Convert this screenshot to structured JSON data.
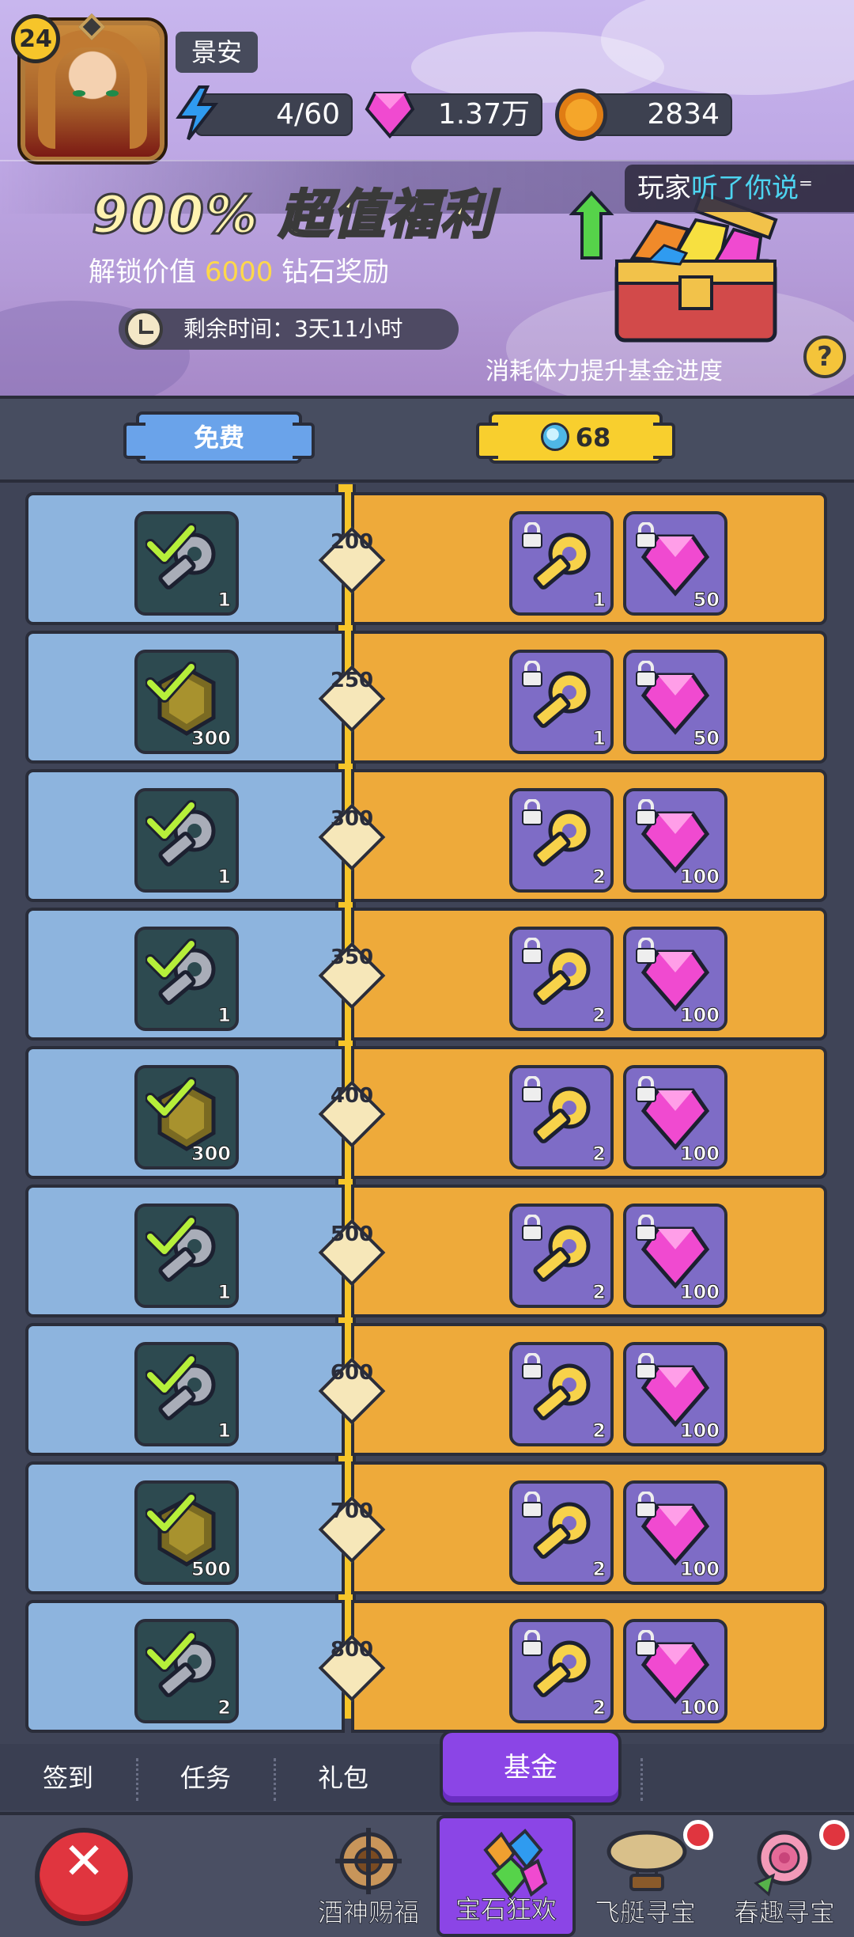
{
  "player": {
    "level": "24",
    "name": "景安"
  },
  "resources": {
    "energy": "4/60",
    "gems": "1.37万",
    "coins": "2834"
  },
  "banner": {
    "title": "900% 超值福利",
    "subtitle_prefix": "解锁价值",
    "subtitle_value": "6000",
    "subtitle_suffix": "钻石奖励",
    "timer": "剩余时间：3天11小时",
    "hint": "消耗体力提升基金进度",
    "listen_prefix": "玩家",
    "listen_highlight": "听了你说"
  },
  "columns": {
    "free_label": "免费",
    "paid_price": "68"
  },
  "rows": [
    {
      "milestone": "200",
      "free": {
        "icon": "key-icon",
        "qty": "1"
      },
      "paid_key_qty": "1",
      "paid_gem_qty": "50"
    },
    {
      "milestone": "250",
      "free": {
        "icon": "coin-icon",
        "qty": "300"
      },
      "paid_key_qty": "1",
      "paid_gem_qty": "50"
    },
    {
      "milestone": "300",
      "free": {
        "icon": "key-icon",
        "qty": "1"
      },
      "paid_key_qty": "2",
      "paid_gem_qty": "100"
    },
    {
      "milestone": "350",
      "free": {
        "icon": "key-icon",
        "qty": "1"
      },
      "paid_key_qty": "2",
      "paid_gem_qty": "100"
    },
    {
      "milestone": "400",
      "free": {
        "icon": "coin-icon",
        "qty": "300"
      },
      "paid_key_qty": "2",
      "paid_gem_qty": "100"
    },
    {
      "milestone": "500",
      "free": {
        "icon": "key-icon",
        "qty": "1"
      },
      "paid_key_qty": "2",
      "paid_gem_qty": "100"
    },
    {
      "milestone": "600",
      "free": {
        "icon": "key-icon",
        "qty": "1"
      },
      "paid_key_qty": "2",
      "paid_gem_qty": "100"
    },
    {
      "milestone": "700",
      "free": {
        "icon": "coin-icon",
        "qty": "500"
      },
      "paid_key_qty": "2",
      "paid_gem_qty": "100"
    },
    {
      "milestone": "800",
      "free": {
        "icon": "key-icon",
        "qty": "2"
      },
      "paid_key_qty": "2",
      "paid_gem_qty": "100"
    }
  ],
  "subtabs": {
    "signin": "签到",
    "tasks": "任务",
    "gifts": "礼包",
    "fund": "基金"
  },
  "bottomnav": {
    "tab1": "酒神赐福",
    "tab2": "宝石狂欢",
    "tab3": "飞艇寻宝",
    "tab4": "春趣寻宝"
  },
  "colors": {
    "free_col": "#8db4de",
    "paid_col": "#eeaa3a",
    "accent": "#8b45e6"
  }
}
